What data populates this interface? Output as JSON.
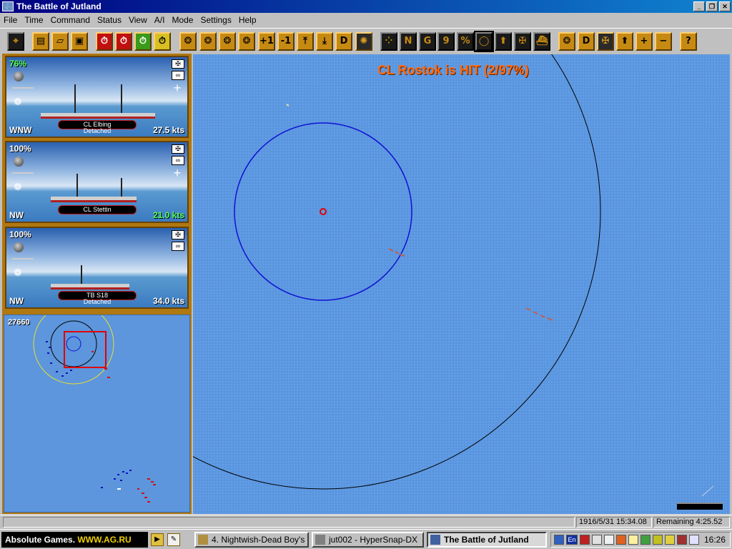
{
  "window": {
    "title": "The Battle of Jutland",
    "controls": [
      "_",
      "❐",
      "✕"
    ]
  },
  "menu": [
    "File",
    "Time",
    "Command",
    "Status",
    "View",
    "A/I",
    "Mode",
    "Settings",
    "Help"
  ],
  "toolbar": {
    "buttons": [
      {
        "label": "⌖",
        "icon": "crosshair-icon",
        "style": "blk"
      },
      {
        "label": "▤",
        "icon": "document-icon"
      },
      {
        "label": "▱",
        "icon": "open-folder-icon"
      },
      {
        "label": "▣",
        "icon": "save-icon"
      },
      {
        "label": "⏱",
        "icon": "time-slow-icon",
        "style": "red"
      },
      {
        "label": "⏱",
        "icon": "time-normal-icon",
        "style": "red"
      },
      {
        "label": "⏱",
        "icon": "time-fast-icon",
        "style": "grn"
      },
      {
        "label": "⏱",
        "icon": "time-fastest-icon",
        "style": "ylw"
      },
      {
        "label": "❂",
        "icon": "ship-gunnery-icon"
      },
      {
        "label": "❂",
        "icon": "ship-torpedo-icon"
      },
      {
        "label": "❂",
        "icon": "ship-smoke-icon"
      },
      {
        "label": "❂",
        "icon": "ship-evade-icon"
      },
      {
        "label": "+1",
        "icon": "speed-up-icon"
      },
      {
        "label": "-1",
        "icon": "speed-down-icon"
      },
      {
        "label": "⤒",
        "icon": "max-speed-icon"
      },
      {
        "label": "⤓",
        "icon": "stop-icon"
      },
      {
        "label": "D",
        "icon": "detach-icon"
      },
      {
        "label": "✺",
        "icon": "smoke-icon",
        "style": "dark"
      },
      {
        "label": "⁘",
        "icon": "grid-dots-icon",
        "style": "blk"
      },
      {
        "label": "N",
        "icon": "north-up-icon",
        "style": "blk"
      },
      {
        "label": "G",
        "icon": "grid-icon",
        "style": "blk"
      },
      {
        "label": "9",
        "icon": "numbers-icon",
        "style": "blk"
      },
      {
        "label": "%",
        "icon": "percent-icon",
        "style": "blk"
      },
      {
        "label": "◯",
        "icon": "range-circle-icon",
        "style": "blk",
        "active": true
      },
      {
        "label": "⬆",
        "icon": "arrow-up-icon",
        "style": "blk"
      },
      {
        "label": "✠",
        "icon": "union-jack-icon",
        "style": "blk"
      },
      {
        "label": "⛴",
        "icon": "ship-icon",
        "style": "blk"
      },
      {
        "label": "❂",
        "icon": "formation-icon"
      },
      {
        "label": "D",
        "icon": "detach-2-icon"
      },
      {
        "label": "✠",
        "icon": "flag-icon",
        "style": "dark"
      },
      {
        "label": "⬆",
        "icon": "arrow-up-2-icon"
      },
      {
        "label": "+",
        "icon": "zoom-in-icon"
      },
      {
        "label": "−",
        "icon": "zoom-out-icon"
      },
      {
        "label": "?",
        "icon": "help-icon"
      }
    ]
  },
  "ships": [
    {
      "pct": "76%",
      "pct_color": "green",
      "heading": "WNW",
      "speed": "27.5 kts",
      "speed_color": "white",
      "name": "CL Elbing",
      "status": "Detached"
    },
    {
      "pct": "100%",
      "pct_color": "white",
      "heading": "NW",
      "speed": "21.0 kts",
      "speed_color": "green",
      "name": "CL Stettin",
      "status": ""
    },
    {
      "pct": "100%",
      "pct_color": "white",
      "heading": "NW",
      "speed": "34.0 kts",
      "speed_color": "white",
      "name": "TB S18",
      "status": "Detached"
    }
  ],
  "minimap": {
    "distance": "27660"
  },
  "map": {
    "hit_message": "CL Rostok is HIT (2/97%)"
  },
  "statusbar": {
    "datetime": "1916/5/31 15:34.08",
    "remaining": "Remaining 4:25.52"
  },
  "taskbar": {
    "brand_prefix": "Absolute Games. ",
    "brand_url": "WWW.AG.RU",
    "tasks": [
      {
        "label": "4. Nightwish-Dead Boy's P...",
        "active": false
      },
      {
        "label": "jut002 - HyperSnap-DX",
        "active": false
      },
      {
        "label": "The Battle of Jutland",
        "active": true
      }
    ],
    "clock": "16:26",
    "lang": "En"
  },
  "colors": {
    "hit_text": "#ff6a10",
    "sea": "#5a96e0",
    "panel_frame": "#b07810",
    "range_circle_blue": "#1010d0"
  }
}
